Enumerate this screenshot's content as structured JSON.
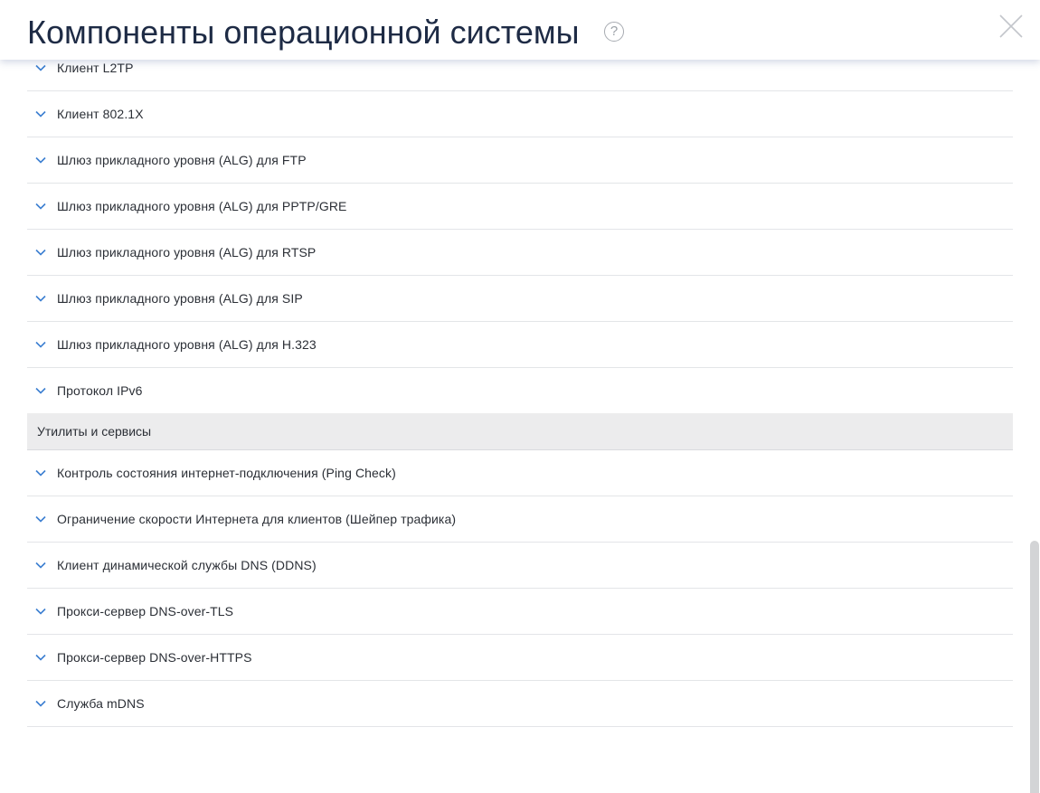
{
  "header": {
    "title": "Компоненты операционной системы",
    "help_glyph": "?",
    "close_icon": "close-icon"
  },
  "list": {
    "group1_items": [
      {
        "label": "Клиент L2TP"
      },
      {
        "label": "Клиент 802.1X"
      },
      {
        "label": "Шлюз прикладного уровня (ALG) для FTP"
      },
      {
        "label": "Шлюз прикладного уровня (ALG) для PPTP/GRE"
      },
      {
        "label": "Шлюз прикладного уровня (ALG) для RTSP"
      },
      {
        "label": "Шлюз прикладного уровня (ALG) для SIP"
      },
      {
        "label": "Шлюз прикладного уровня (ALG) для H.323"
      },
      {
        "label": "Протокол IPv6"
      }
    ],
    "section_title": "Утилиты и сервисы",
    "group2_items": [
      {
        "label": "Контроль состояния интернет-подключения (Ping Check)"
      },
      {
        "label": "Ограничение скорости Интернета для клиентов (Шейпер трафика)"
      },
      {
        "label": "Клиент динамической службы DNS (DDNS)"
      },
      {
        "label": "Прокси-сервер DNS-over-TLS"
      },
      {
        "label": "Прокси-сервер DNS-over-HTTPS"
      },
      {
        "label": "Служба mDNS"
      }
    ]
  },
  "colors": {
    "title": "#1e2b45",
    "chevron": "#3c7fd1",
    "divider": "#e3e5e8",
    "section_bg": "#ececed"
  }
}
